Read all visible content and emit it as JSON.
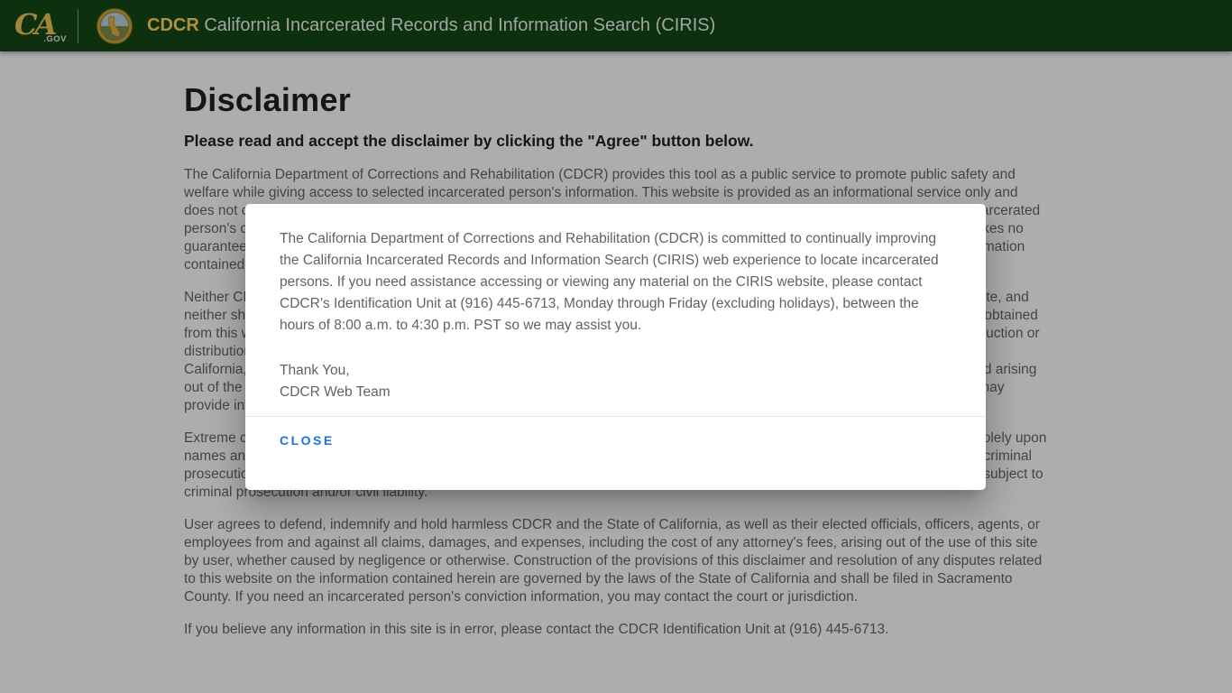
{
  "header": {
    "ca_logo": {
      "ca": "CA",
      "gov": ".GOV"
    },
    "icons": {
      "seal": "cdcr-seal-icon",
      "ca_gov": "ca-gov-logo"
    },
    "brand": "CDCR",
    "title": "California Incarcerated Records and Information Search (CIRIS)",
    "colors": {
      "bar_green": "#144716",
      "brand_gold": "#ffd75e"
    }
  },
  "page": {
    "heading": "Disclaimer",
    "subheading": "Please read and accept the disclaimer by clicking the \"Agree\" button below.",
    "paragraphs": [
      "The California Department of Corrections and Rehabilitation (CDCR) provides this tool as a public service to promote public safety and welfare while giving access to selected incarcerated person's information. This website is provided as an informational service only and does not constitute, and should not be relied upon as, an official record of CDCR. It may contain errors and may not reflect an incarcerated person's complete criminal history, current location, commitment county, admitted offenses, or scheduled release date. CDCR makes no guarantee as to the accuracy or completeness of the information, and assumes no responsibility for any failure to update the information contained in this website.",
      "Neither CDCR nor the State of California warrants the accuracy, reliability, or timeliness of any information published on this website, and neither shall accept responsibility for any errors or omissions contained herein. Any person or entity that relies on any information obtained from this website does so at his or her own risk, and the user shall assume full responsibility for use of the information. Any reproduction or distribution of the information, without the prior written consent of the user, may subject the user to liability. CDCR and the State of California, as well as their elected officials, officers, agents, or employees, shall not be liable for any damages or losses of any kind arising out of the use of, or the inability to use, this website. This disclaimer applies to CDCR, the State of California, and any entity that may provide information for this website, none of whom warrant the accuracy or completeness of the information contained herein.",
      "Extreme care should be used when attempting to identify a specific individual based upon information contained herein. Relying solely upon names and/or dates of birth may lead to misidentification. Misuse of any of the information in this website may subject the user to criminal prosecution and/or civil liability.Unauthorized attempts to change the information in this website are strictly prohibited and may be subject to criminal prosecution and/or civil liability.",
      "User agrees to defend, indemnify and hold harmless CDCR and the State of California, as well as their elected officials, officers, agents, or employees from and against all claims, damages, and expenses, including the cost of any attorney's fees, arising out of the use of this site by user, whether caused by negligence or otherwise. Construction of the provisions of this disclaimer and resolution of any disputes related to this website on the information contained herein are governed by the laws of the State of California and shall be filed in Sacramento County. If you need an incarcerated person's conviction information, you may contact the court or jurisdiction.",
      "If you believe any information in this site is in error, please contact the CDCR Identification Unit at (916) 445-6713."
    ]
  },
  "modal": {
    "body": "The California Department of Corrections and Rehabilitation (CDCR) is committed to continually improving the California Incarcerated Records and Information Search (CIRIS) web experience to locate incarcerated persons. If you need assistance accessing or viewing any material on the CIRIS website, please contact CDCR’s Identification Unit at (916) 445-6713, Monday through Friday (excluding holidays), between the hours of 8:00 a.m. to 4:30 p.m. PST so we may assist you.",
    "signoff_line1": "Thank You,",
    "signoff_line2": "CDCR Web Team",
    "close_label": "CLOSE",
    "colors": {
      "close_blue": "#1a73e8"
    }
  }
}
